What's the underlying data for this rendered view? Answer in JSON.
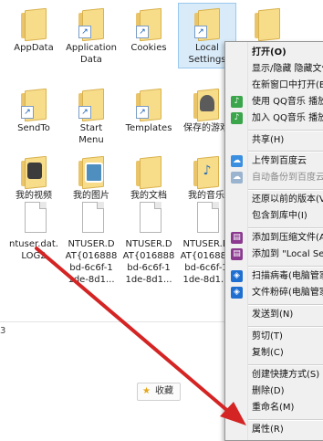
{
  "files": [
    {
      "label": "AppData",
      "icon": "folder-icon"
    },
    {
      "label": "Application\nData",
      "icon": "folder-shortcut-icon"
    },
    {
      "label": "Cookies",
      "icon": "folder-shortcut-icon"
    },
    {
      "label": "Local\nSettings",
      "icon": "folder-shortcut-icon"
    },
    {
      "label": "SendTo",
      "icon": "folder-shortcut-icon"
    },
    {
      "label": "Start\nMenu",
      "icon": "folder-shortcut-icon"
    },
    {
      "label": "Templates",
      "icon": "folder-shortcut-icon"
    },
    {
      "label": "保存的游戏",
      "icon": "saved-games-folder-icon"
    },
    {
      "label": "我的视频",
      "icon": "videos-folder-icon"
    },
    {
      "label": "我的图片",
      "icon": "pictures-folder-icon"
    },
    {
      "label": "我的文档",
      "icon": "documents-folder-icon"
    },
    {
      "label": "我的音乐",
      "icon": "music-folder-icon"
    },
    {
      "label": "ntuser.dat.\nLOG2",
      "icon": "file-icon"
    },
    {
      "label": "NTUSER.D\nAT{016888\nbd-6c6f-1\n1de-8d1...",
      "icon": "file-icon"
    },
    {
      "label": "NTUSER.D\nAT{016888\nbd-6c6f-1\n1de-8d1...",
      "icon": "file-icon"
    },
    {
      "label": "NTUSER.D\nAT{016888\nbd-6c6f-1\n1de-8d1...",
      "icon": "file-icon"
    }
  ],
  "status": {
    "count_text": "3"
  },
  "favorite": {
    "label": "收藏"
  },
  "context_menu": {
    "items": [
      {
        "label": "打开(O)",
        "bold": true
      },
      {
        "label": "显示/隐藏 隐藏文件"
      },
      {
        "label": "在新窗口中打开(E)"
      },
      {
        "label": "使用 QQ音乐 播放",
        "icon": "qq-music-icon"
      },
      {
        "label": "加入 QQ音乐 播放",
        "icon": "qq-music-icon"
      },
      {
        "label": "共享(H)"
      },
      {
        "label": "上传到百度云",
        "icon": "baidu-cloud-icon"
      },
      {
        "label": "自动备份到百度云",
        "icon": "baidu-cloud-icon",
        "disabled": true
      },
      {
        "label": "还原以前的版本(V)"
      },
      {
        "label": "包含到库中(I)"
      },
      {
        "label": "添加到压缩文件(A)...",
        "icon": "archive-icon"
      },
      {
        "label": "添加到 \"Local Sett",
        "icon": "archive-icon"
      },
      {
        "label": "扫描病毒(电脑管家)",
        "icon": "pc-manager-icon"
      },
      {
        "label": "文件粉碎(电脑管家)",
        "icon": "pc-manager-icon"
      },
      {
        "label": "发送到(N)"
      },
      {
        "label": "剪切(T)"
      },
      {
        "label": "复制(C)"
      },
      {
        "label": "创建快捷方式(S)"
      },
      {
        "label": "删除(D)"
      },
      {
        "label": "重命名(M)"
      },
      {
        "label": "属性(R)"
      }
    ]
  },
  "colors": {
    "arrow": "#d42424",
    "selection": "#d9ebf9",
    "menu_bg": "#f0f0f0"
  }
}
